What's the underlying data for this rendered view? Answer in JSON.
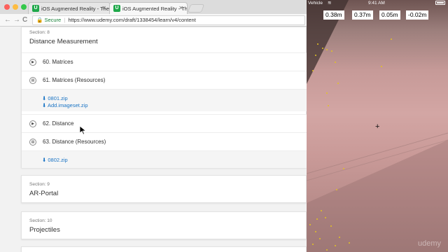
{
  "browser": {
    "tabs": [
      {
        "favicon": "U",
        "title": "iOS Augmented Reality - The C",
        "active": false
      },
      {
        "favicon": "U",
        "title": "iOS Augmented Reality - The C",
        "active": true
      }
    ],
    "nav": {
      "back": "←",
      "forward": "→",
      "reload": "C"
    },
    "address": {
      "lock_icon": "🔒",
      "secure_label": "Secure",
      "separator": "|",
      "url": "https://www.udemy.com/draft/1338454/learn/v4/content"
    }
  },
  "curriculum": {
    "section8": {
      "label": "Section: 8",
      "title": "Distance Measurement",
      "lectures": [
        {
          "icon": "play",
          "glyph": "▶",
          "text": "60.  Matrices"
        },
        {
          "icon": "document",
          "glyph": "▤",
          "text": "61.  Matrices (Resources)"
        },
        {
          "icon": "play",
          "glyph": "▶",
          "text": "62.  Distance"
        },
        {
          "icon": "document",
          "glyph": "▤",
          "text": "63.  Distance (Resources)"
        }
      ],
      "resources_61": [
        "0801.zip",
        "Add.imageset.zip"
      ],
      "resources_63": [
        "0802.zip"
      ]
    },
    "section9": {
      "label": "Section: 9",
      "title": "AR-Portal"
    },
    "section10": {
      "label": "Section: 10",
      "title": "Projectiles"
    }
  },
  "ar_view": {
    "status": {
      "carrier": "Vehicle",
      "time": "9:41 AM",
      "wifi_icon": "wifi-icon",
      "battery_icon": "battery-icon"
    },
    "measurements": [
      "0.38m",
      "0.37m",
      "0.05m",
      "-0.02m"
    ],
    "crosshair": "+",
    "watermark": "udemy"
  },
  "colors": {
    "link": "#1a74c4",
    "secure": "#188038",
    "feature_point": "#e3c323"
  }
}
